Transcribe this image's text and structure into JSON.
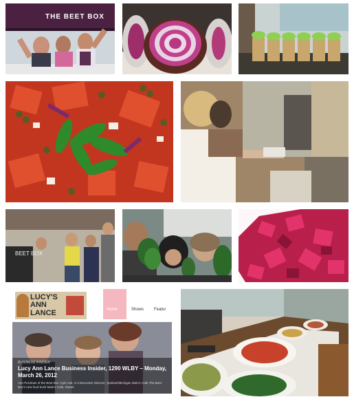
{
  "collage": {
    "tiles": [
      {
        "id": "truck-crew",
        "sign": "THE BEET BOX"
      },
      {
        "id": "beet-halves"
      },
      {
        "id": "cups-on-counter"
      },
      {
        "id": "salad-closeup"
      },
      {
        "id": "service-window"
      },
      {
        "id": "crew-at-truck",
        "chalkboard": "BEET BOX"
      },
      {
        "id": "greens-held"
      },
      {
        "id": "diced-beets"
      },
      {
        "id": "blog-screenshot",
        "logo_lines": [
          "THE",
          "LUCY'S",
          "ANN",
          "LANCE"
        ],
        "nav": [
          "Home",
          "Shows",
          "Featur"
        ],
        "post_meta": "BUSINESS INSIDER",
        "post_title": "Lucy Ann Lance Business Insider, 1290 WLBY – Monday, March 26, 2012",
        "post_excerpt": "Ann Perdman of the Beet Box. Kyle Ault, S.3 Executive Director, Ypsilanti/Michigan Main's Cafe The Beet Box's new food truck Main's Cafe, Owner"
      },
      {
        "id": "buffet-table"
      }
    ]
  }
}
